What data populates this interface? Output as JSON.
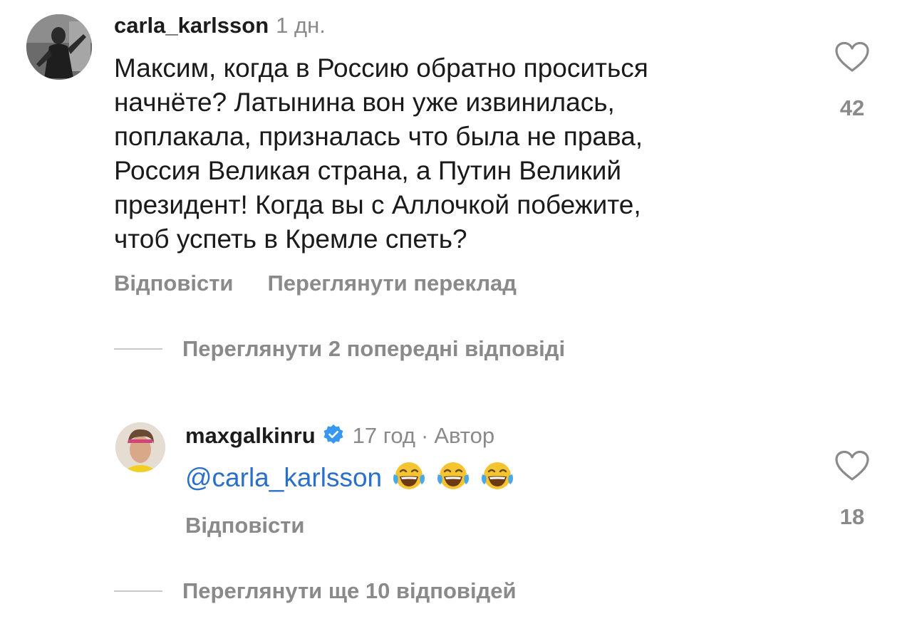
{
  "comment": {
    "username": "carla_karlsson",
    "time": "1 дн.",
    "lines": [
      "Максим, когда в Россию обратно проситься",
      "начнёте? Латынина вон уже извинилась,",
      "поплакала, призналась что была не права,",
      "Россия Великая страна, а Путин Великий",
      "президент! Когда вы с Аллочкой побежите,",
      "чтоб успеть в Кремле спеть?"
    ],
    "reply_label": "Відповісти",
    "translate_label": "Переглянути переклад",
    "like_count": "42",
    "avatar_icon": "profile-photo"
  },
  "view_previous": "Переглянути 2 попередні відповіді",
  "reply": {
    "username": "maxgalkinru",
    "verified_icon": "verified-badge-icon",
    "time": "17 год",
    "separator": "·",
    "author_label": "Автор",
    "mention": "@carla_karlsson",
    "emojis": [
      "face-with-tears-of-joy",
      "face-with-tears-of-joy",
      "face-with-tears-of-joy"
    ],
    "reply_label": "Відповісти",
    "like_count": "18"
  },
  "view_more": "Переглянути ще 10 відповідей",
  "colors": {
    "text": "#1c1c1c",
    "muted": "#8a8a8a",
    "link": "#2a6fc9",
    "verified": "#3897f0"
  }
}
